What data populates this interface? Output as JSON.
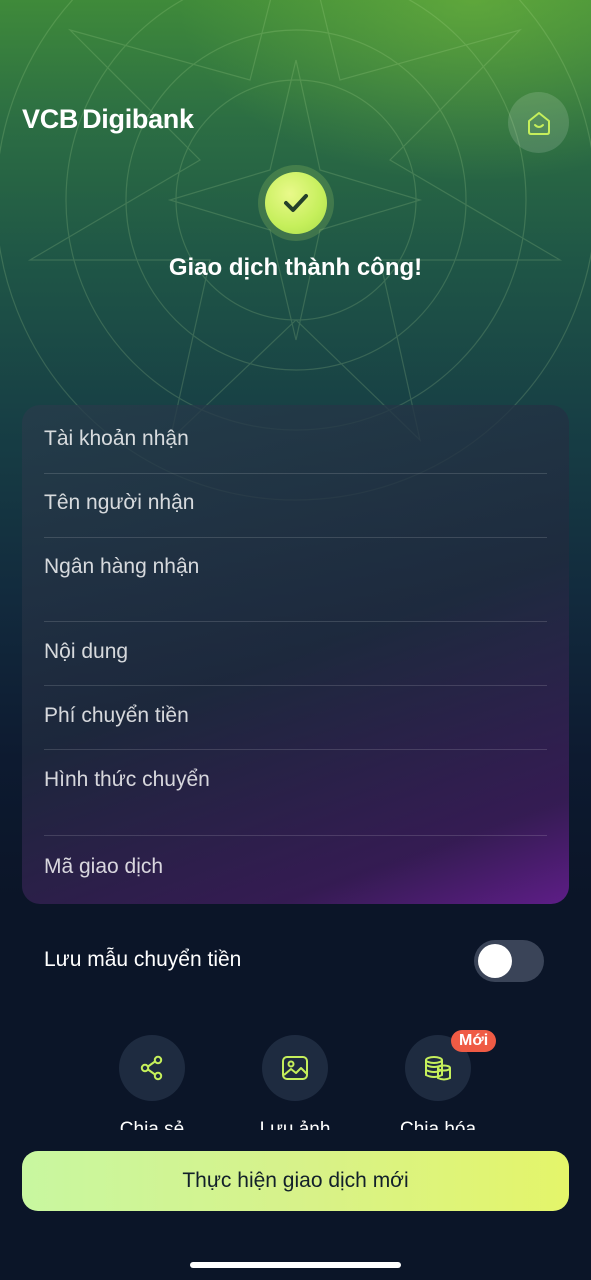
{
  "header": {
    "logo_vcb": "VCB",
    "logo_digibank": "Digibank"
  },
  "success": {
    "title": "Giao dịch thành công!"
  },
  "details": {
    "rows": [
      {
        "label": "Tài khoản nhận"
      },
      {
        "label": "Tên người nhận"
      },
      {
        "label": "Ngân hàng nhận"
      },
      {
        "label": "Nội dung"
      },
      {
        "label": "Phí chuyển tiền"
      },
      {
        "label": "Hình thức chuyển"
      },
      {
        "label": "Mã giao dịch"
      }
    ]
  },
  "save_template": {
    "label": "Lưu mẫu chuyển tiền",
    "enabled": false
  },
  "actions": [
    {
      "label": "Chia sẻ",
      "icon": "share-icon"
    },
    {
      "label": "Lưu ảnh",
      "icon": "image-icon"
    },
    {
      "label": "Chia hóa",
      "icon": "coins-icon",
      "badge": "Mới"
    }
  ],
  "primary_button": {
    "label": "Thực hiện giao dịch mới"
  },
  "colors": {
    "accent": "#c5ef5b",
    "badge": "#ef5b45",
    "background": "#0b1528"
  }
}
